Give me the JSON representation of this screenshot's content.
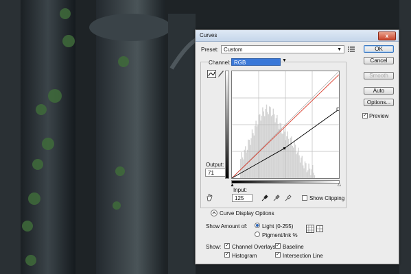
{
  "dialog": {
    "title": "Curves",
    "close_glyph": "x",
    "preset_label": "Preset:",
    "preset_value": "Custom",
    "channel_label": "Channel:",
    "channel_value": "RGB",
    "output_label": "Output:",
    "output_value": "71",
    "input_label": "Input:",
    "input_value": "125",
    "show_clipping_label": "Show Clipping",
    "show_clipping_checked": false,
    "curve_display_options_label": "Curve Display Options",
    "show_amount_label": "Show Amount of:",
    "light_label": "Light  (0-255)",
    "light_selected": true,
    "pigment_label": "Pigment/Ink %",
    "show_label": "Show:",
    "channel_overlays_label": "Channel Overlays",
    "baseline_label": "Baseline",
    "histogram_label": "Histogram",
    "intersection_line_label": "Intersection Line",
    "channel_overlays_checked": true,
    "baseline_checked": true,
    "histogram_checked": true,
    "intersection_line_checked": true
  },
  "buttons": {
    "ok": "OK",
    "cancel": "Cancel",
    "smooth": "Smooth",
    "auto": "Auto",
    "options": "Options...",
    "preview_label": "Preview",
    "preview_checked": true
  },
  "check_mark": "✓",
  "curve": {
    "control_point": {
      "input": 125,
      "output": 71
    },
    "end_point": {
      "input": 255,
      "output": 164
    }
  },
  "icons": [
    "curve-tool-icon",
    "pencil-icon",
    "black-eyedropper-icon",
    "gray-eyedropper-icon",
    "white-eyedropper-icon",
    "hand-adjust-icon",
    "preset-menu-icon",
    "expand-chevron-icon",
    "grid-small-icon",
    "grid-large-icon"
  ],
  "colors": {
    "accent": "#3a78c2",
    "red_curve": "#d93a2a",
    "black_curve": "#000000",
    "histogram": "#d4d4d4"
  }
}
